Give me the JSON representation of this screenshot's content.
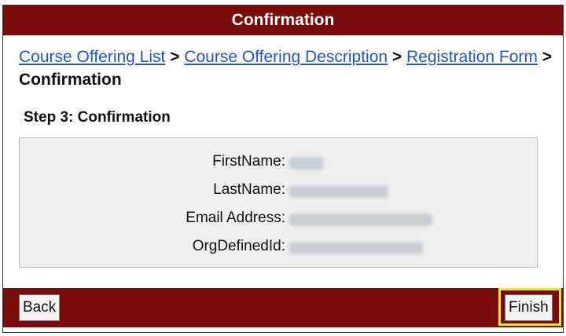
{
  "header": {
    "title": "Confirmation"
  },
  "breadcrumb": {
    "items": [
      {
        "label": "Course Offering List"
      },
      {
        "label": "Course Offering Description"
      },
      {
        "label": "Registration Form"
      }
    ],
    "separator": ">",
    "current": "Confirmation"
  },
  "step": {
    "title": "Step 3: Confirmation"
  },
  "fields": [
    {
      "label": "FirstName:",
      "value_redacted": true
    },
    {
      "label": "LastName:",
      "value_redacted": true
    },
    {
      "label": "Email Address:",
      "value_redacted": true
    },
    {
      "label": "OrgDefinedId:",
      "value_redacted": true
    }
  ],
  "footer": {
    "back_label": "Back",
    "finish_label": "Finish"
  },
  "colors": {
    "header_bg": "#7b0a0a",
    "link": "#1f56c9",
    "highlight": "#e8e82a",
    "box_bg": "#efefef"
  }
}
